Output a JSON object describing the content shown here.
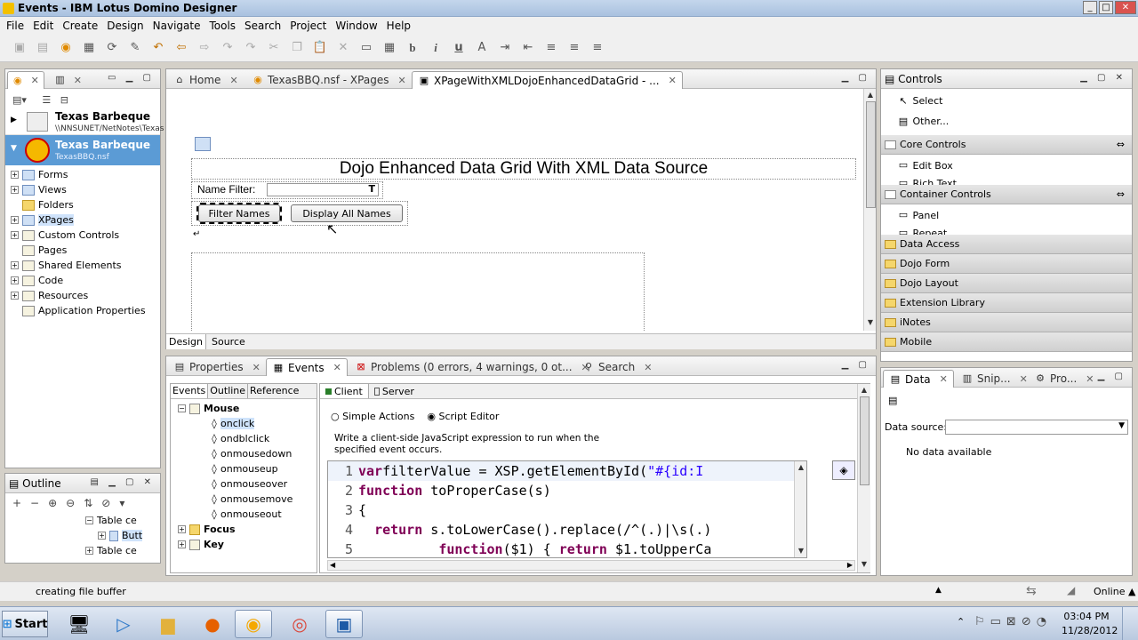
{
  "window": {
    "title": "Events - IBM Lotus Domino Designer",
    "btn_min": "_",
    "btn_max": "□",
    "btn_close": "✕"
  },
  "menu": [
    "File",
    "Edit",
    "Create",
    "Design",
    "Navigate",
    "Tools",
    "Search",
    "Project",
    "Window",
    "Help"
  ],
  "nav": {
    "apps": [
      {
        "title": "Texas Barbeque",
        "path": "\\\\NNSUNET/NetNotes\\Texas"
      },
      {
        "title": "Texas Barbeque",
        "path": "TexasBBQ.nsf"
      }
    ],
    "items": [
      "Forms",
      "Views",
      "Folders",
      "XPages",
      "Custom Controls",
      "Pages",
      "Shared Elements",
      "Code",
      "Resources",
      "Application Properties"
    ]
  },
  "outline": {
    "title": "Outline",
    "rows": [
      "Table ce",
      "Butt",
      "Table ce"
    ]
  },
  "editor": {
    "tabs": [
      "Home",
      "TexasBBQ.nsf - XPages",
      "XPageWithXMLDojoEnhancedDataGrid - ..."
    ],
    "heading": "Dojo Enhanced Data Grid With XML Data Source",
    "name_filter_label": "Name Filter:",
    "filter_btn": "Filter Names",
    "display_btn": "Display All Names",
    "mode_tabs": [
      "Design",
      "Source"
    ]
  },
  "bottom": {
    "tabs": [
      "Properties",
      "Events",
      "Problems (0 errors, 4 warnings, 0 ot...",
      "Search"
    ],
    "subtabs": [
      "Events",
      "Outline",
      "Reference"
    ],
    "groups": {
      "mouse": "Mouse",
      "events": [
        "onclick",
        "ondblclick",
        "onmousedown",
        "onmouseup",
        "onmouseover",
        "onmousemove",
        "onmouseout"
      ],
      "focus": "Focus",
      "key": "Key"
    },
    "client_tab": "Client",
    "server_tab": "Server",
    "simple_actions": "Simple Actions",
    "script_editor": "Script Editor",
    "description": "Write a client-side JavaScript expression to run when the specified event occurs.",
    "code": [
      {
        "n": "1",
        "parts": [
          [
            "kw",
            "var"
          ],
          [
            "",
            "filterValue = XSP.getElementById("
          ],
          [
            "str",
            "\"#{id:I"
          ]
        ]
      },
      {
        "n": "2",
        "parts": [
          [
            "kw",
            "function"
          ],
          [
            "",
            " toProperCase(s)"
          ]
        ]
      },
      {
        "n": "3",
        "parts": [
          [
            "",
            "{"
          ]
        ]
      },
      {
        "n": "4",
        "parts": [
          [
            "",
            "  "
          ],
          [
            "kw",
            "return"
          ],
          [
            "",
            " s.toLowerCase().replace(/^(.)|\\s(.)"
          ]
        ]
      },
      {
        "n": "5",
        "parts": [
          [
            "",
            "          "
          ],
          [
            "kw",
            "function"
          ],
          [
            "",
            "($1) { "
          ],
          [
            "kw",
            "return"
          ],
          [
            "",
            " $1.toUpperCa"
          ]
        ]
      }
    ]
  },
  "controls": {
    "title": "Controls",
    "basic": [
      "Select",
      "Other..."
    ],
    "core": {
      "title": "Core Controls",
      "items": [
        "Edit Box",
        "Rich Text"
      ]
    },
    "container": {
      "title": "Container Controls",
      "items": [
        "Panel",
        "Repeat"
      ]
    },
    "categories": [
      "Data Access",
      "Dojo Form",
      "Dojo Layout",
      "Extension Library",
      "iNotes",
      "Mobile"
    ]
  },
  "data_panel": {
    "tabs": [
      "Data",
      "Snip...",
      "Pro..."
    ],
    "source_label": "Data source:",
    "empty": "No data available"
  },
  "status": {
    "text": "creating file buffer",
    "online": "Online"
  },
  "taskbar": {
    "start": "Start",
    "time": "03:04 PM",
    "date": "11/28/2012"
  }
}
